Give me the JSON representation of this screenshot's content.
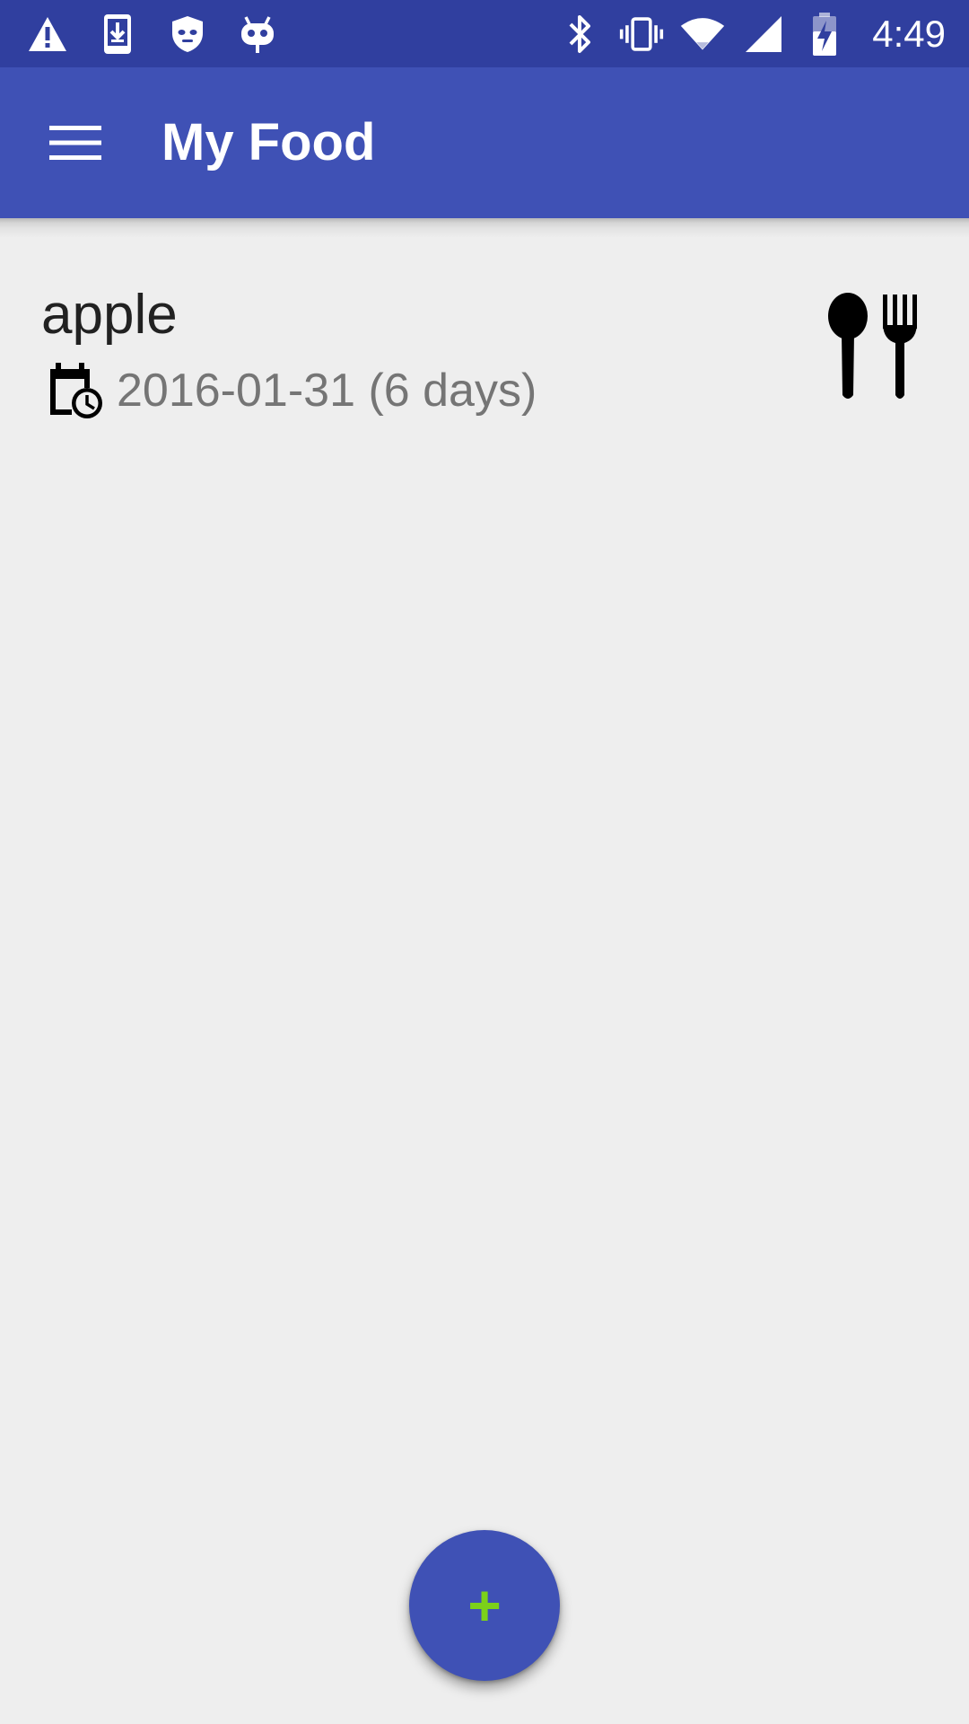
{
  "status_bar": {
    "time": "4:49",
    "left_icons": [
      "warning-icon",
      "download-icon",
      "shield-icon",
      "cyanogen-icon"
    ],
    "right_icons": [
      "bluetooth-icon",
      "vibrate-icon",
      "wifi-icon",
      "cellular-signal-icon",
      "battery-charging-icon"
    ]
  },
  "app_bar": {
    "title": "My Food",
    "menu_icon": "hamburger-menu-icon",
    "background_color": "#3f51b5",
    "status_bar_color": "#303f9f"
  },
  "food_list": {
    "items": [
      {
        "name": "apple",
        "date": "2016-01-31 (6 days)",
        "date_icon": "calendar-clock-icon",
        "action_icon": "spoon-fork-icon"
      }
    ]
  },
  "fab": {
    "label": "+",
    "icon": "add-icon",
    "background_color": "#3f51b5",
    "plus_color": "#7cd11a"
  }
}
